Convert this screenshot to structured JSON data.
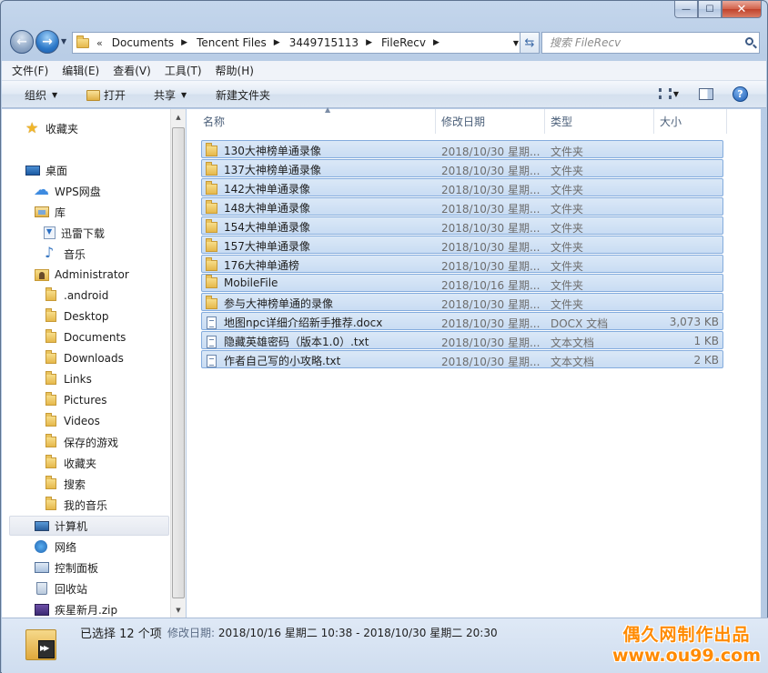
{
  "window": {
    "caption_buttons": {
      "minimize": "—",
      "maximize": "☐",
      "close": "✕"
    }
  },
  "nav": {
    "breadcrumb": [
      "Documents",
      "Tencent Files",
      "3449715113",
      "FileRecv"
    ],
    "overflow": "«",
    "search_placeholder": "搜索 FileRecv"
  },
  "menu": [
    "文件(F)",
    "编辑(E)",
    "查看(V)",
    "工具(T)",
    "帮助(H)"
  ],
  "toolbar": {
    "organize": "组织",
    "open": "打开",
    "share": "共享",
    "new_folder": "新建文件夹",
    "help": "?"
  },
  "sidebar": {
    "favorites": "收藏夹",
    "desktop": "桌面",
    "wps": "WPS网盘",
    "library": "库",
    "xunlei": "迅雷下载",
    "music": "音乐",
    "admin": "Administrator",
    "folders": [
      ".android",
      "Desktop",
      "Documents",
      "Downloads",
      "Links",
      "Pictures",
      "Videos",
      "保存的游戏",
      "收藏夹",
      "搜索",
      "我的音乐"
    ],
    "computer": "计算机",
    "network": "网络",
    "control_panel": "控制面板",
    "recycle": "回收站",
    "zip": "疾星新月.zip"
  },
  "columns": {
    "name": "名称",
    "date": "修改日期",
    "type": "类型",
    "size": "大小"
  },
  "files": [
    {
      "name": "130大神榜单通录像",
      "date": "2018/10/30 星期...",
      "type": "文件夹",
      "size": "",
      "icon": "folder-icon"
    },
    {
      "name": "137大神榜单通录像",
      "date": "2018/10/30 星期...",
      "type": "文件夹",
      "size": "",
      "icon": "folder-icon"
    },
    {
      "name": "142大神单通录像",
      "date": "2018/10/30 星期...",
      "type": "文件夹",
      "size": "",
      "icon": "folder-icon"
    },
    {
      "name": "148大神单通录像",
      "date": "2018/10/30 星期...",
      "type": "文件夹",
      "size": "",
      "icon": "folder-icon"
    },
    {
      "name": "154大神单通录像",
      "date": "2018/10/30 星期...",
      "type": "文件夹",
      "size": "",
      "icon": "folder-icon"
    },
    {
      "name": "157大神单通录像",
      "date": "2018/10/30 星期...",
      "type": "文件夹",
      "size": "",
      "icon": "folder-icon"
    },
    {
      "name": "176大神单通榜",
      "date": "2018/10/30 星期...",
      "type": "文件夹",
      "size": "",
      "icon": "folder-icon"
    },
    {
      "name": "MobileFile",
      "date": "2018/10/16 星期...",
      "type": "文件夹",
      "size": "",
      "icon": "folder-icon"
    },
    {
      "name": "参与大神榜单通的录像",
      "date": "2018/10/30 星期...",
      "type": "文件夹",
      "size": "",
      "icon": "folder-icon"
    },
    {
      "name": "地图npc详细介绍新手推荐.docx",
      "date": "2018/10/30 星期...",
      "type": "DOCX 文档",
      "size": "3,073 KB",
      "icon": "document-icon"
    },
    {
      "name": "隐藏英雄密码（版本1.0）.txt",
      "date": "2018/10/30 星期...",
      "type": "文本文档",
      "size": "1 KB",
      "icon": "document-icon"
    },
    {
      "name": "作者自己写的小攻略.txt",
      "date": "2018/10/30 星期...",
      "type": "文本文档",
      "size": "2 KB",
      "icon": "document-icon"
    }
  ],
  "status": {
    "selected": "已选择 12 个项",
    "modified_label": "修改日期:",
    "modified_range": "2018/10/16 星期二 10:38 - 2018/10/30 星期二 20:30"
  },
  "watermark": {
    "line1": "偶久网制作出品",
    "line2": "www.ou99.com"
  }
}
